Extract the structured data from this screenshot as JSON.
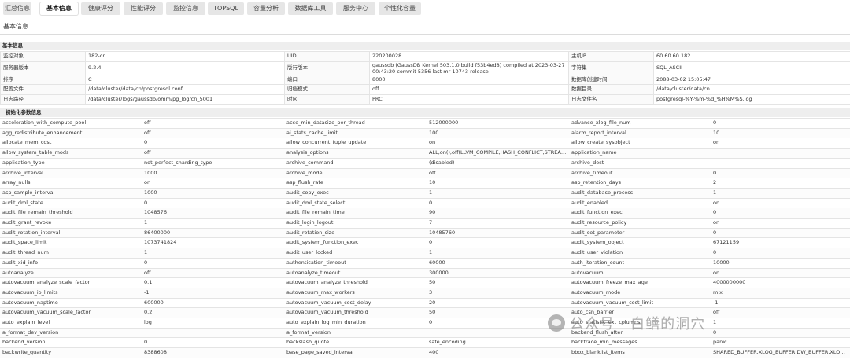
{
  "tabs": [
    {
      "label": "汇总信息"
    },
    {
      "label": "基本信息"
    },
    {
      "label": "健康评分"
    },
    {
      "label": "性能评分"
    },
    {
      "label": "监控信息"
    },
    {
      "label": "TOPSQL"
    },
    {
      "label": "容量分析"
    },
    {
      "label": "数据库工具"
    },
    {
      "label": "服务中心"
    },
    {
      "label": "个性化容量"
    }
  ],
  "breadcrumb": "基本信息",
  "basic_section_title": "基本信息",
  "basic_rows": [
    [
      "监控对象",
      "182-cn",
      "UID",
      "220200028",
      "主机IP",
      "60.60.60.182"
    ],
    [
      "服务器版本",
      "9.2.4",
      "版行版本",
      "gaussdb (GaussDB Kernel 503.1.0 build f53b4ed8) compiled at 2023-03-27 00:43:20 commit 5356 last mr 10743 release",
      "字符集",
      "SQL_ASCII"
    ],
    [
      "排序",
      "C",
      "端口",
      "8000",
      "数据库创建时间",
      "2088-03-02 15:05:47"
    ],
    [
      "配置文件",
      "/data/cluster/data/cn/postgresql.conf",
      "归档模式",
      "off",
      "数据目录",
      "/data/cluster/data/cn"
    ],
    [
      "日志路径",
      "/data/cluster/logs/gaussdb/omm/pg_log/cn_5001",
      "时区",
      "PRC",
      "日志文件名",
      "postgresql-%Y-%m-%d_%H%M%S.log"
    ]
  ],
  "params_section_title": "初始化参数信息",
  "params_rows": [
    [
      "acceleration_with_compute_pool",
      "off",
      "acce_min_datasize_per_thread",
      "512000000",
      "advance_xlog_file_num",
      "0"
    ],
    [
      "agg_redistribute_enhancement",
      "off",
      "ai_stats_cache_limit",
      "100",
      "alarm_report_interval",
      "10"
    ],
    [
      "allocate_mem_cost",
      "0",
      "allow_concurrent_tuple_update",
      "on",
      "allow_create_sysobject",
      "on"
    ],
    [
      "allow_system_table_mods",
      "off",
      "analysis_options",
      "ALL,on(),off(LLVM_COMPILE,HASH_CONFLICT,STREAM_DAT...",
      "application_name",
      ""
    ],
    [
      "application_type",
      "not_perfect_sharding_type",
      "archive_command",
      "(disabled)",
      "archive_dest",
      ""
    ],
    [
      "archive_interval",
      "1000",
      "archive_mode",
      "off",
      "archive_timeout",
      "0"
    ],
    [
      "array_nulls",
      "on",
      "asp_flush_rate",
      "10",
      "asp_retention_days",
      "2"
    ],
    [
      "asp_sample_interval",
      "1000",
      "audit_copy_exec",
      "1",
      "audit_database_process",
      "1"
    ],
    [
      "audit_dml_state",
      "0",
      "audit_dml_state_select",
      "0",
      "audit_enabled",
      "on"
    ],
    [
      "audit_file_remain_threshold",
      "1048576",
      "audit_file_remain_time",
      "90",
      "audit_function_exec",
      "0"
    ],
    [
      "audit_grant_revoke",
      "1",
      "audit_login_logout",
      "7",
      "audit_resource_policy",
      "on"
    ],
    [
      "audit_rotation_interval",
      "86400000",
      "audit_rotation_size",
      "10485760",
      "audit_set_parameter",
      "0"
    ],
    [
      "audit_space_limit",
      "1073741824",
      "audit_system_function_exec",
      "0",
      "audit_system_object",
      "67121159"
    ],
    [
      "audit_thread_num",
      "1",
      "audit_user_locked",
      "1",
      "audit_user_violation",
      "0"
    ],
    [
      "audit_xid_info",
      "0",
      "authentication_timeout",
      "60000",
      "auth_iteration_count",
      "10000"
    ],
    [
      "autoanalyze",
      "off",
      "autoanalyze_timeout",
      "300000",
      "autovacuum",
      "on"
    ],
    [
      "autovacuum_analyze_scale_factor",
      "0.1",
      "autovacuum_analyze_threshold",
      "50",
      "autovacuum_freeze_max_age",
      "4000000000"
    ],
    [
      "autovacuum_io_limits",
      "-1",
      "autovacuum_max_workers",
      "3",
      "autovacuum_mode",
      "mix"
    ],
    [
      "autovacuum_naptime",
      "600000",
      "autovacuum_vacuum_cost_delay",
      "20",
      "autovacuum_vacuum_cost_limit",
      "-1"
    ],
    [
      "autovacuum_vacuum_scale_factor",
      "0.2",
      "autovacuum_vacuum_threshold",
      "50",
      "auto_csn_barrier",
      "off"
    ],
    [
      "auto_explain_level",
      "log",
      "auto_explain_log_min_duration",
      "0",
      "auto_statistic_ext_columns",
      "1"
    ],
    [
      "a_format_dev_version",
      "",
      "a_format_version",
      "",
      "backend_flush_after",
      "0"
    ],
    [
      "backend_version",
      "0",
      "backslash_quote",
      "safe_encoding",
      "backtrace_min_messages",
      "panic"
    ],
    [
      "backwrite_quantity",
      "8388608",
      "base_page_saved_interval",
      "400",
      "bbox_blanklist_items",
      "SHARED_BUFFER,XLOG_BUFFER,DW_BUFFER,XLOG_MESSA..."
    ]
  ],
  "watermark": "公众号 · 白鳝的洞穴"
}
